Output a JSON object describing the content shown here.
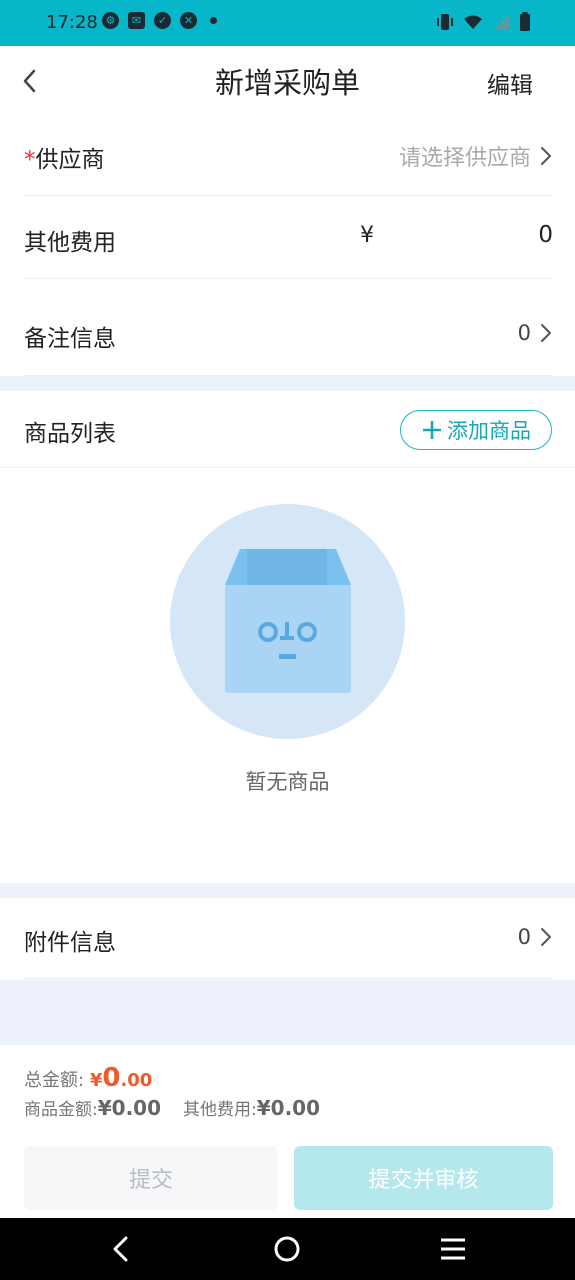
{
  "status_bar": {
    "time": "17:28",
    "left_icons": [
      "gear-icon",
      "mail-icon",
      "check-circle-icon",
      "shield-icon",
      "dot-icon"
    ],
    "right_icons": [
      "vibrate-icon",
      "wifi-icon",
      "signal-icon",
      "battery-icon"
    ]
  },
  "navbar": {
    "title": "新增采购单",
    "edit_label": "编辑"
  },
  "form": {
    "supplier_required_mark": "*",
    "supplier_label": "供应商",
    "supplier_placeholder": "请选择供应商",
    "other_fees_label": "其他费用",
    "currency_symbol": "¥",
    "other_fees_value": "0",
    "remarks_label": "备注信息",
    "remarks_count": "0"
  },
  "products": {
    "title": "商品列表",
    "add_label": "添加商品",
    "empty_text": "暂无商品"
  },
  "attachments": {
    "label": "附件信息",
    "count": "0"
  },
  "summary": {
    "total_label": "总金额:",
    "total_currency": "¥",
    "total_int": "0",
    "total_dec": ".00",
    "goods_label": "商品金额:",
    "goods_value": "¥0.00",
    "fees_label": "其他费用:",
    "fees_value": "¥0.00"
  },
  "actions": {
    "submit_label": "提交",
    "submit_audit_label": "提交并审核"
  },
  "colors": {
    "accent": "#07b7c9",
    "button_accent_disabled": "#b4e8ed",
    "price": "#ef5a2a",
    "required": "#e53935",
    "page_gap": "#edf1fb"
  },
  "system_nav": [
    "back-triangle-icon",
    "home-circle-icon",
    "recents-menu-icon"
  ]
}
